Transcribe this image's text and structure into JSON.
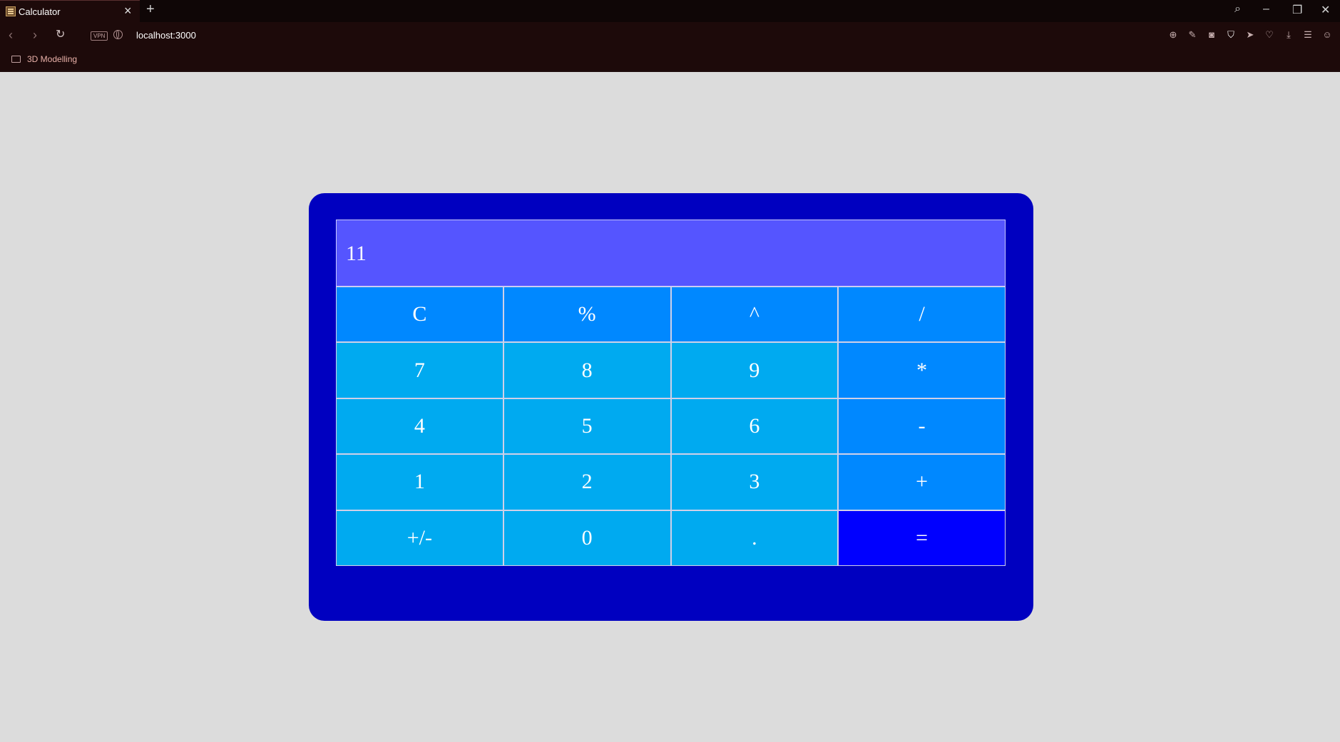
{
  "browser": {
    "tab_title": "Calculator",
    "url": "localhost:3000",
    "vpn_badge": "VPN",
    "bookmark": "3D Modelling"
  },
  "calculator": {
    "display": "11",
    "keys": [
      {
        "label": "C",
        "type": "op"
      },
      {
        "label": "%",
        "type": "op"
      },
      {
        "label": "^",
        "type": "op"
      },
      {
        "label": "/",
        "type": "op"
      },
      {
        "label": "7",
        "type": "num"
      },
      {
        "label": "8",
        "type": "num"
      },
      {
        "label": "9",
        "type": "num"
      },
      {
        "label": "*",
        "type": "op"
      },
      {
        "label": "4",
        "type": "num"
      },
      {
        "label": "5",
        "type": "num"
      },
      {
        "label": "6",
        "type": "num"
      },
      {
        "label": "-",
        "type": "op"
      },
      {
        "label": "1",
        "type": "num"
      },
      {
        "label": "2",
        "type": "num"
      },
      {
        "label": "3",
        "type": "num"
      },
      {
        "label": "+",
        "type": "op"
      },
      {
        "label": "+/-",
        "type": "num"
      },
      {
        "label": "0",
        "type": "num"
      },
      {
        "label": ".",
        "type": "num"
      },
      {
        "label": "=",
        "type": "eq"
      }
    ]
  },
  "colors": {
    "frame": "#0000c0",
    "display": "#5555ff",
    "number_key": "#00aaf0",
    "operator_key": "#0088ff",
    "equals_key": "#0000ff",
    "page_background": "#dcdcdc"
  }
}
